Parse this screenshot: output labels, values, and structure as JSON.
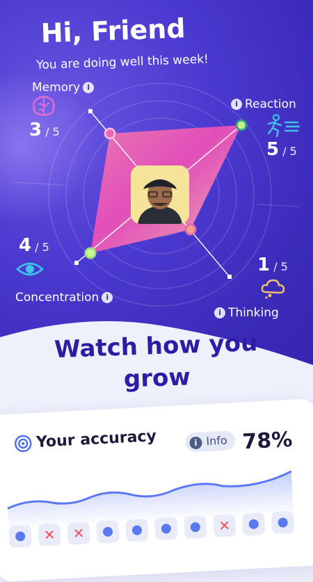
{
  "greeting": "Hi, Friend",
  "subtitle": "You are doing well this week!",
  "skills": {
    "memory": {
      "label": "Memory",
      "score": "3",
      "max": "/ 5"
    },
    "reaction": {
      "label": "Reaction",
      "score": "5",
      "max": "/ 5"
    },
    "concentration": {
      "label": "Concentration",
      "score": "4",
      "max": "/ 5"
    },
    "thinking": {
      "label": "Thinking",
      "score": "1",
      "max": "/ 5"
    }
  },
  "info_glyph": "i",
  "headline": {
    "line1": "Watch how you",
    "line2": "grow"
  },
  "accuracy": {
    "title": "Your accuracy",
    "info_label": "Info",
    "percent": "78%",
    "results_row1": [
      "correct",
      "wrong",
      "wrong",
      "correct",
      "correct",
      "correct",
      "correct",
      "wrong",
      "correct",
      "correct"
    ]
  },
  "colors": {
    "hero": "#3a2ab8",
    "accent": "#2b1ea5",
    "correct": "#5a78f0",
    "wrong": "#ef4e5a"
  }
}
